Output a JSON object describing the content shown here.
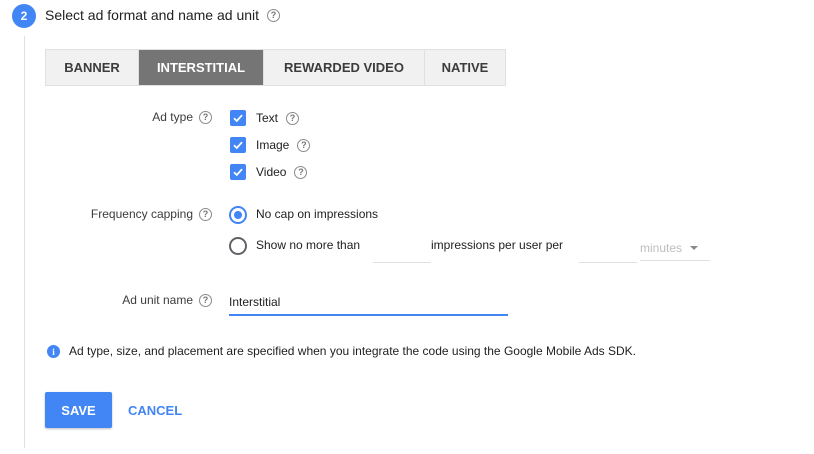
{
  "step": {
    "number": "2",
    "title": "Select ad format and name ad unit"
  },
  "format_tabs": [
    {
      "label": "BANNER",
      "active": false
    },
    {
      "label": "INTERSTITIAL",
      "active": true
    },
    {
      "label": "REWARDED VIDEO",
      "active": false
    },
    {
      "label": "NATIVE",
      "active": false
    }
  ],
  "ad_type": {
    "label": "Ad type",
    "options": [
      {
        "label": "Text",
        "checked": true
      },
      {
        "label": "Image",
        "checked": true
      },
      {
        "label": "Video",
        "checked": true
      }
    ]
  },
  "frequency_capping": {
    "label": "Frequency capping",
    "options": {
      "no_cap": {
        "label": "No cap on impressions",
        "selected": true
      },
      "cap": {
        "label": "Show no more than",
        "selected": false
      }
    },
    "impressions_value": "",
    "middle_text": "impressions per user per",
    "period_value": "",
    "unit_select": "minutes"
  },
  "ad_unit_name": {
    "label": "Ad unit name",
    "value": "Interstitial"
  },
  "info_text": "Ad type, size, and placement are specified when you integrate the code using the Google Mobile Ads SDK.",
  "actions": {
    "save_label": "SAVE",
    "cancel_label": "CANCEL"
  },
  "colors": {
    "accent": "#4285f4",
    "tab_active_bg": "#757575",
    "tab_bg": "#f1f1f1"
  }
}
